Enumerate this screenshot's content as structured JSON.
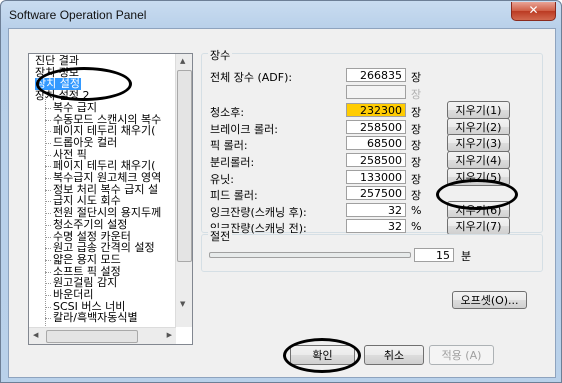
{
  "window": {
    "title": "Software Operation Panel",
    "close_glyph": "✕"
  },
  "tree": {
    "items": [
      {
        "label": "진단 결과"
      },
      {
        "label": "장치 정보"
      },
      {
        "label": "장치 설정",
        "selected": true
      },
      {
        "label": "장치 설정 2"
      },
      {
        "label": "복수 급지"
      },
      {
        "label": "수동모드 스캔시의 복수"
      },
      {
        "label": "페이지 테두리 채우기("
      },
      {
        "label": "드롭아웃 컬러"
      },
      {
        "label": "사전 픽"
      },
      {
        "label": "페이지 테두리 채우기("
      },
      {
        "label": "복수급지 원고체크 영역"
      },
      {
        "label": "정보 처리 복수 급지 설"
      },
      {
        "label": "급지 시도 회수"
      },
      {
        "label": "전원 절단시의 용지두께"
      },
      {
        "label": "청소주기의 설정"
      },
      {
        "label": "수명 설정 카운터"
      },
      {
        "label": "원고 급송 간격의 설정"
      },
      {
        "label": "얇은 용지 모드"
      },
      {
        "label": "소프트 픽 설정"
      },
      {
        "label": "원고걸림 감지"
      },
      {
        "label": "바운더리"
      },
      {
        "label": "SCSI 버스 너비"
      },
      {
        "label": "칼라/흑백자동식별"
      }
    ]
  },
  "counters": {
    "legend": "장수",
    "rows": [
      {
        "label": "전체 장수 (ADF):",
        "value": "266835",
        "unit": "장"
      },
      {
        "label": "",
        "value": "",
        "unit": "장",
        "dim": true
      },
      {
        "label": "청소후:",
        "value": "232300",
        "unit": "장",
        "warn": true,
        "button": "지우기(1)"
      },
      {
        "label": "브레이크 롤러:",
        "value": "258500",
        "unit": "장",
        "button": "지우기(2)"
      },
      {
        "label": "픽 롤러:",
        "value": "68500",
        "unit": "장",
        "button": "지우기(3)"
      },
      {
        "label": "분리롤러:",
        "value": "258500",
        "unit": "장",
        "button": "지우기(4)"
      },
      {
        "label": "유닛:",
        "value": "133000",
        "unit": "장",
        "button": "지우기(5)"
      },
      {
        "label": "피드 롤러:",
        "value": "257500",
        "unit": "장"
      },
      {
        "label": "잉크잔량(스캐닝 후):",
        "value": "32",
        "unit": "%",
        "button": "지우기(6)"
      },
      {
        "label": "잉크잔량(스캐닝 전):",
        "value": "32",
        "unit": "%",
        "button": "지우기(7)"
      }
    ]
  },
  "power_save": {
    "legend": "절전",
    "value": "15",
    "unit": "분"
  },
  "buttons": {
    "offset": "오프셋(O)...",
    "ok": "확인",
    "cancel": "취소",
    "apply": "적용 (A)"
  },
  "scroll_glyphs": {
    "up": "▲",
    "down": "▼",
    "left": "◀",
    "right": "▶"
  }
}
